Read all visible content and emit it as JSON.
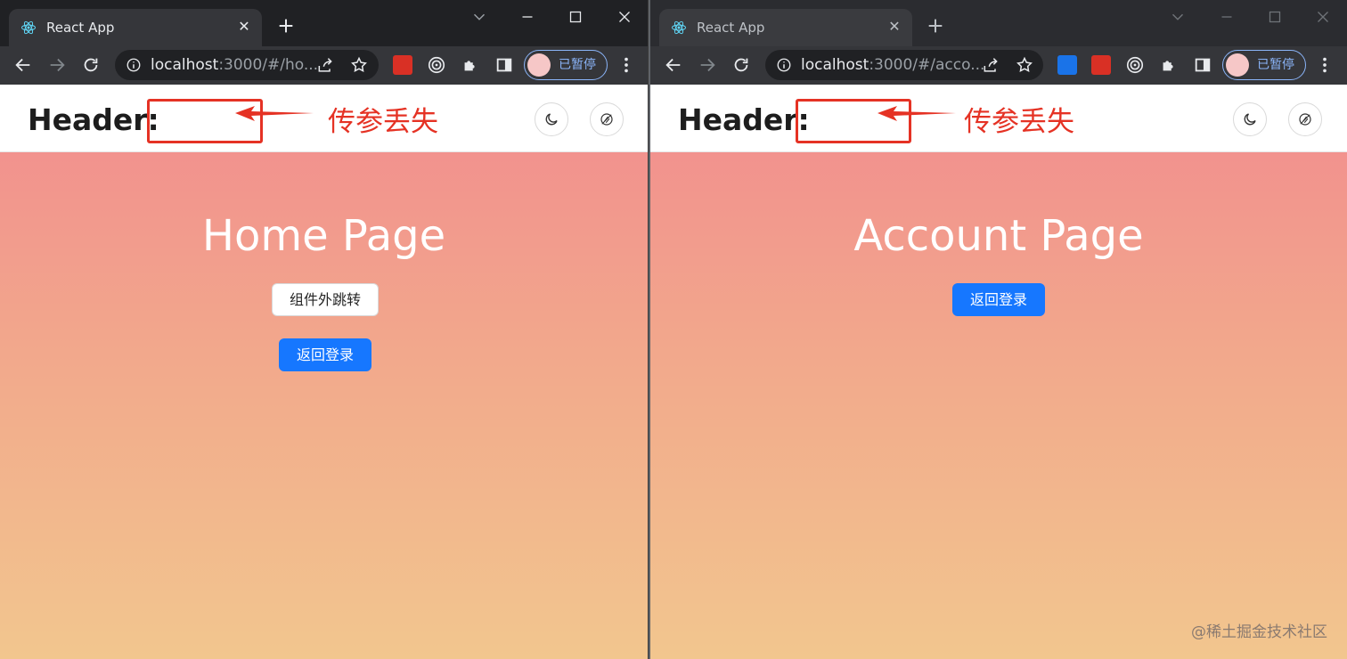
{
  "windows": [
    {
      "tab_title": "React App",
      "url_host": "localhost",
      "url_rest": ":3000/#/ho...",
      "profile_label": "已暂停",
      "header_label": "Header:",
      "annotation": "传参丢失",
      "page_title": "Home Page",
      "outside_nav_button": "组件外跳转",
      "back_login_button": "返回登录"
    },
    {
      "tab_title": "React App",
      "url_host": "localhost",
      "url_rest": ":3000/#/acco...",
      "profile_label": "已暂停",
      "header_label": "Header:",
      "annotation": "传参丢失",
      "page_title": "Account Page",
      "back_login_button": "返回登录"
    }
  ],
  "watermark": "@稀土掘金技术社区",
  "colors": {
    "accent": "#1677ff",
    "annotation_red": "#e53224",
    "gradient_top": "#f28b8e",
    "gradient_bottom": "#f2c68e"
  }
}
